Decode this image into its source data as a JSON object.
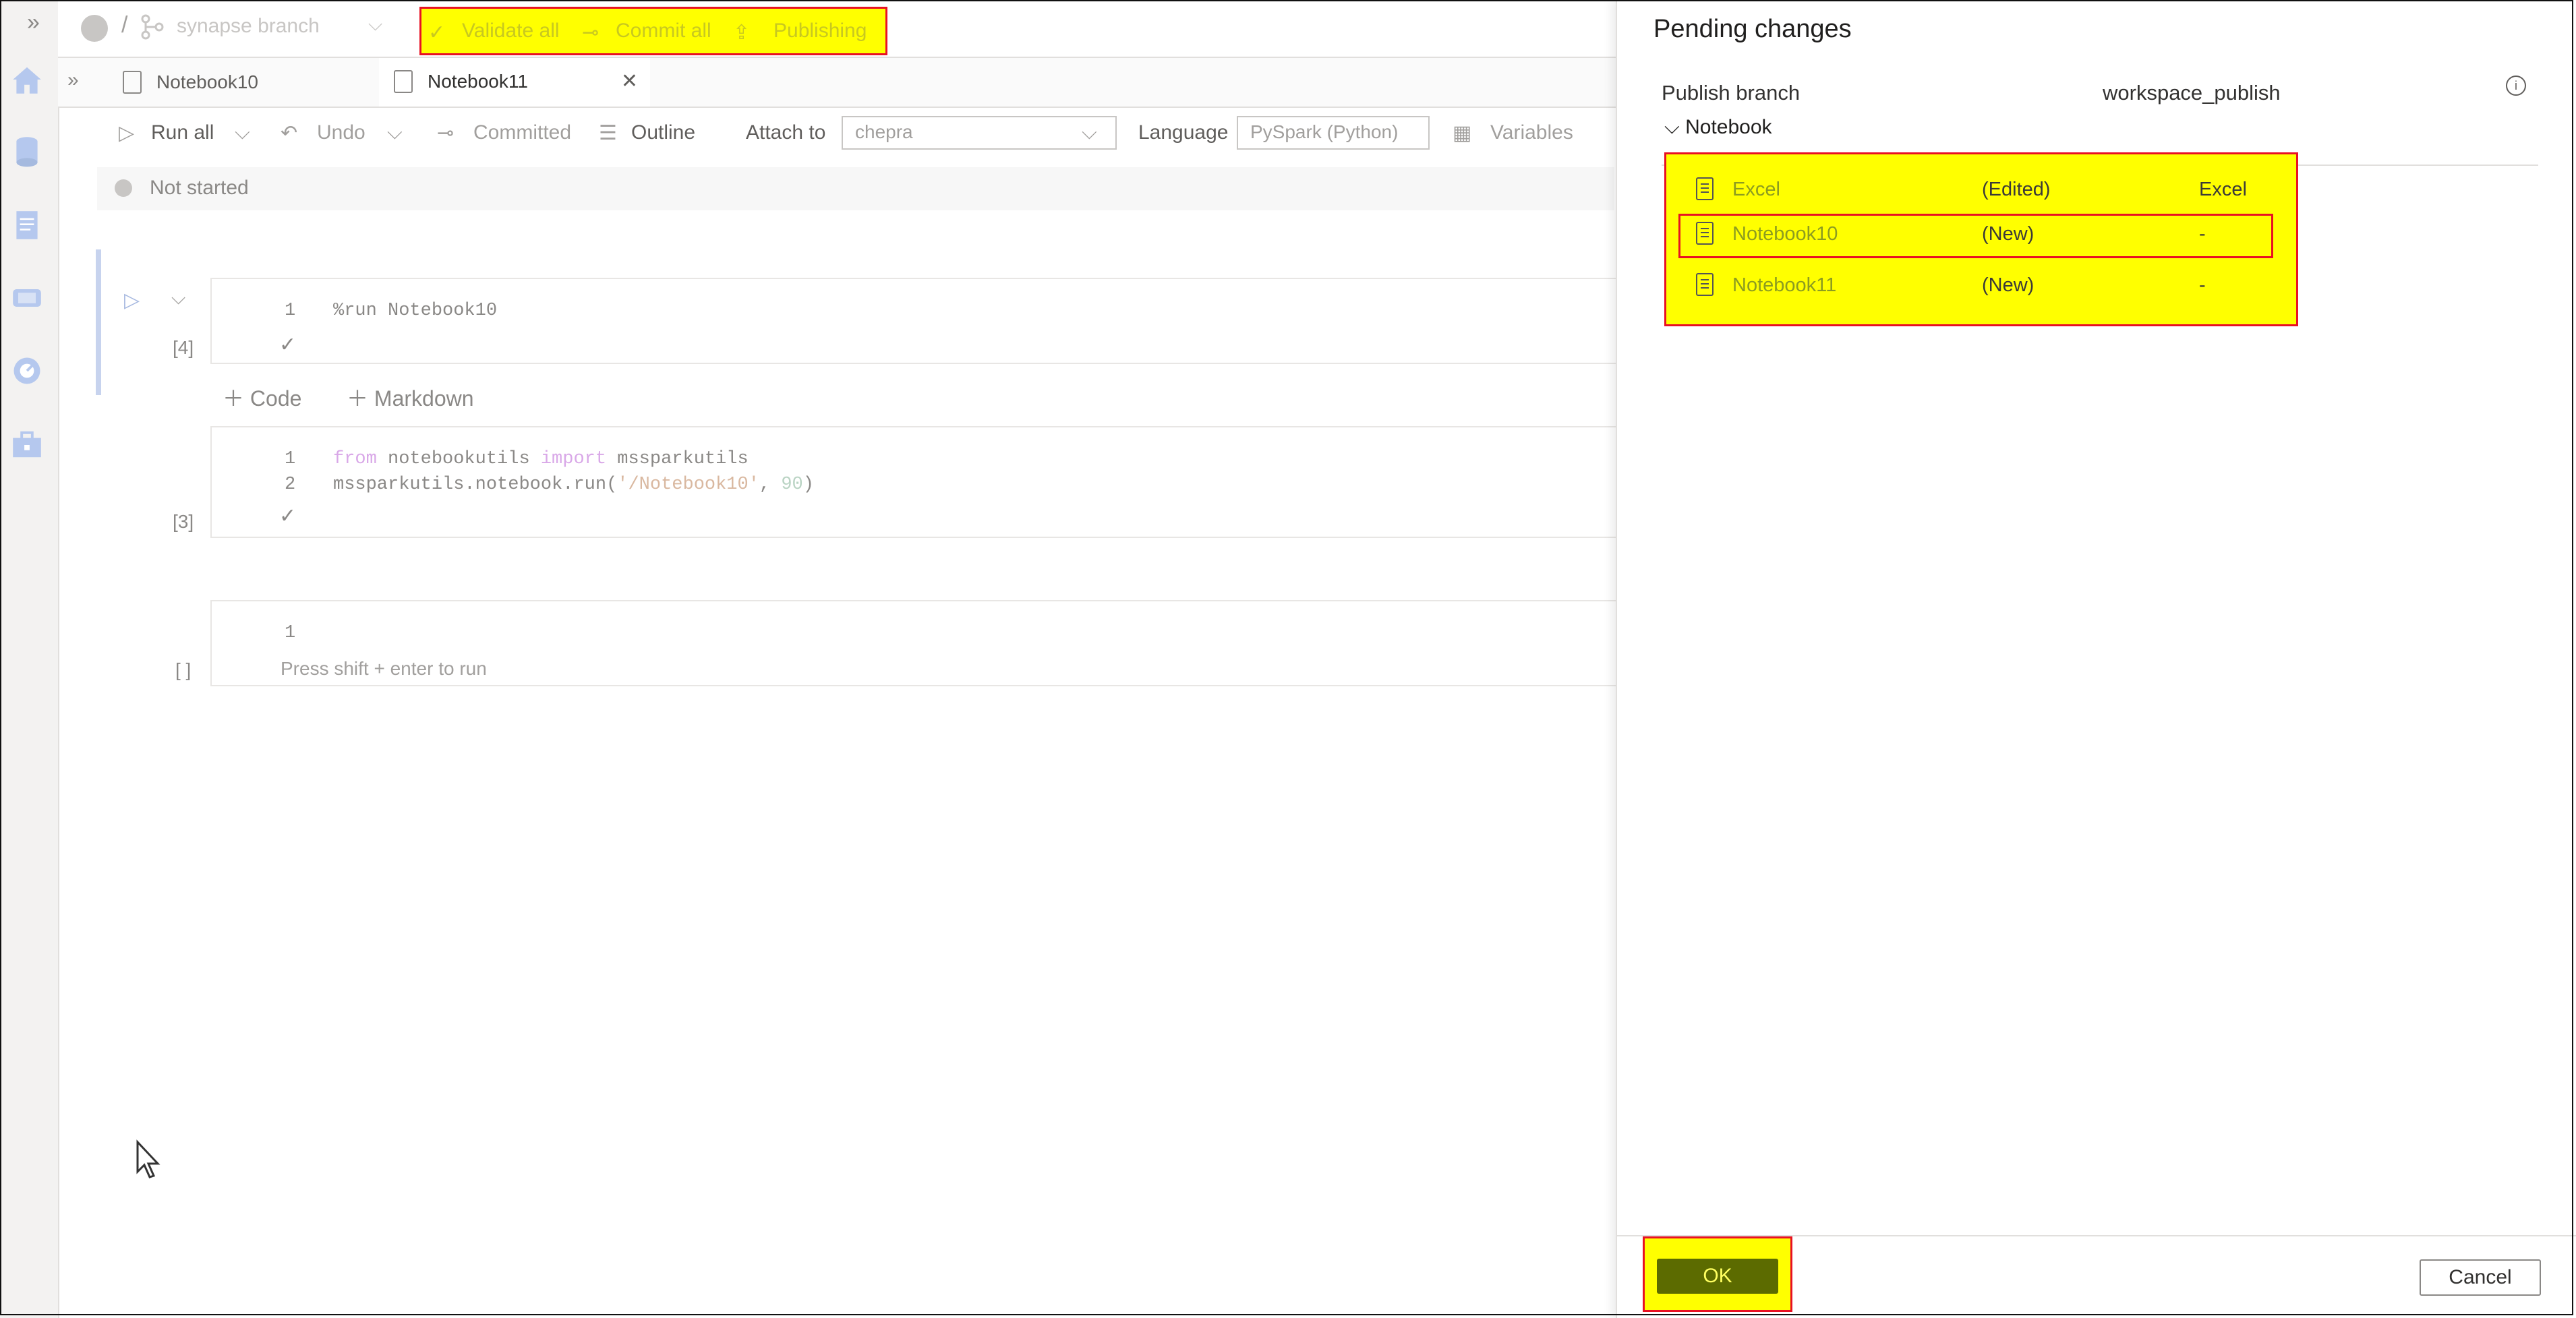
{
  "topbar": {
    "branch": "synapse branch",
    "actions": [
      {
        "label": "Validate all",
        "icon": "validate-icon"
      },
      {
        "label": "Commit all",
        "icon": "commit-icon"
      },
      {
        "label": "Publishing",
        "icon": "publish-icon"
      }
    ]
  },
  "tabs": [
    {
      "label": "Notebook10",
      "active": false
    },
    {
      "label": "Notebook11",
      "active": true
    }
  ],
  "toolbar": {
    "run_all": "Run all",
    "undo": "Undo",
    "committed": "Committed",
    "outline": "Outline",
    "attach_to_label": "Attach to",
    "attach_to_value": "chepra",
    "language_label": "Language",
    "language_value": "PySpark (Python)",
    "variables": "Variables"
  },
  "status": "Not started",
  "cells": [
    {
      "exec": "[4]",
      "lines": [
        {
          "n": "1",
          "code": "%run Notebook10"
        }
      ]
    },
    {
      "exec": "[3]",
      "lines": [
        {
          "n": "1",
          "kw1": "from",
          "mid1": " notebookutils ",
          "kw2": "import",
          "tail1": " mssparkutils"
        },
        {
          "n": "2",
          "pre": "mssparkutils.notebook.run(",
          "str": "'/Notebook10'",
          "sep": ", ",
          "num": "90",
          "post": ")"
        }
      ]
    },
    {
      "exec": "[ ]",
      "lines": [
        {
          "n": "1",
          "code": ""
        }
      ],
      "hint": "Press shift + enter to run"
    }
  ],
  "add_cell": {
    "code": "Code",
    "markdown": "Markdown"
  },
  "panel": {
    "title": "Pending changes",
    "publish_branch_label": "Publish branch",
    "publish_branch_value": "workspace_publish",
    "group": "Notebook",
    "rows": [
      {
        "name": "Excel",
        "change": "(Edited)",
        "type": "Excel"
      },
      {
        "name": "Notebook10",
        "change": "(New)",
        "type": "-"
      },
      {
        "name": "Notebook11",
        "change": "(New)",
        "type": "-"
      }
    ],
    "ok": "OK",
    "cancel": "Cancel"
  },
  "colors": {
    "highlight": "#ffff00",
    "highlight_border": "#e81123",
    "ok_button": "#5c6b00"
  }
}
